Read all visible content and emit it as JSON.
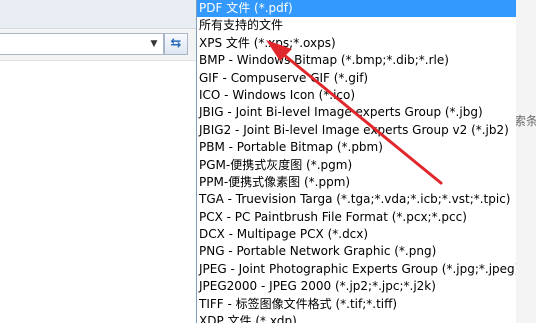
{
  "no_results_text": "没有与搜索条件匹配",
  "refresh_icon": "refresh-icon",
  "dropdown_icon": "chevron-down-icon",
  "colors": {
    "selected_bg": "#3399ff",
    "arrow": "#e0272b"
  },
  "file_types": {
    "selected_index": 0,
    "items": [
      "PDF 文件 (*.pdf)",
      "所有支持的文件",
      "XPS 文件 (*.xps;*.oxps)",
      "BMP - Windows Bitmap (*.bmp;*.dib;*.rle)",
      "GIF - Compuserve GIF (*.gif)",
      "ICO - Windows Icon (*.ico)",
      "JBIG - Joint Bi-level Image experts Group (*.jbg)",
      "JBIG2 - Joint Bi-level Image experts Group v2 (*.jb2)",
      "PBM - Portable Bitmap (*.pbm)",
      "PGM-便携式灰度图 (*.pgm)",
      "PPM-便携式像素图 (*.ppm)",
      "TGA - Truevision Targa (*.tga;*.vda;*.icb;*.vst;*.tpic)",
      "PCX - PC Paintbrush File Format (*.pcx;*.pcc)",
      "DCX - Multipage PCX (*.dcx)",
      "PNG - Portable Network Graphic (*.png)",
      "JPEG - Joint Photographic Experts Group (*.jpg;*.jpeg)",
      "JPEG2000 - JPEG 2000 (*.jp2;*.jpc;*.j2k)",
      "TIFF - 标签图像文件格式 (*.tif;*.tiff)",
      "XDP 文件 (*.xdp)"
    ]
  }
}
